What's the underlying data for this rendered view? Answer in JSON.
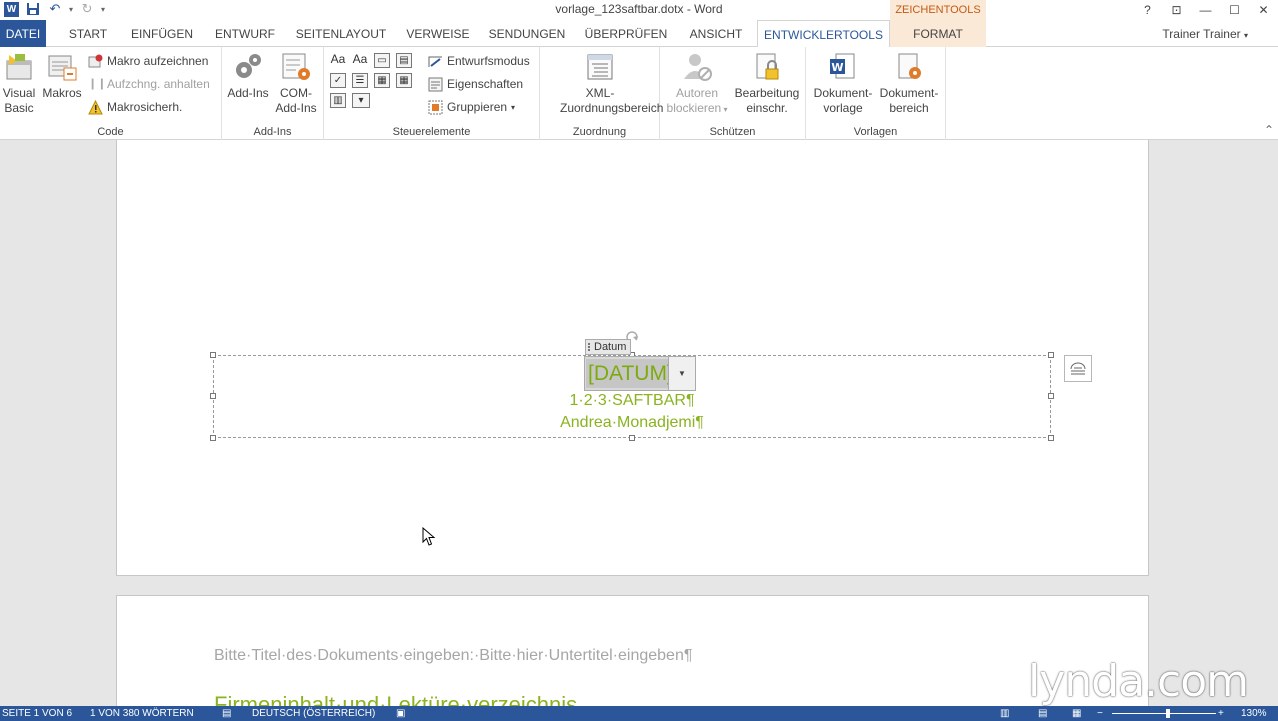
{
  "window": {
    "title": "vorlage_123saftbar.dotx - Word",
    "context_tab_group": "ZEICHENTOOLS",
    "controls": [
      "?",
      "⊡",
      "—",
      "☐",
      "✕"
    ]
  },
  "tabs": [
    {
      "label": "DATEI"
    },
    {
      "label": "START"
    },
    {
      "label": "EINFÜGEN"
    },
    {
      "label": "ENTWURF"
    },
    {
      "label": "SEITENLAYOUT"
    },
    {
      "label": "VERWEISE"
    },
    {
      "label": "SENDUNGEN"
    },
    {
      "label": "ÜBERPRÜFEN"
    },
    {
      "label": "ANSICHT"
    },
    {
      "label": "ENTWICKLERTOOLS"
    },
    {
      "label": "FORMAT"
    }
  ],
  "user": "Trainer Trainer",
  "ribbon": {
    "code": {
      "label": "Code",
      "visual_basic": "Visual Basic",
      "makros": "Makros",
      "makro_aufzeichnen": "Makro aufzeichnen",
      "aufzeichnung_anhalten": "Aufzchng. anhalten",
      "makrosicherheit": "Makrosicherh."
    },
    "addins": {
      "label": "Add-Ins",
      "add_ins": "Add-Ins",
      "com_add_ins": "COM-Add-Ins"
    },
    "steuerelemente": {
      "label": "Steuerelemente",
      "entwurfsmodus": "Entwurfsmodus",
      "eigenschaften": "Eigenschaften",
      "gruppieren": "Gruppieren"
    },
    "zuordnung": {
      "label": "Zuordnung",
      "xml": "XML-Zuordnungsbereich"
    },
    "schuetzen": {
      "label": "Schützen",
      "autoren_blockieren": "Autoren blockieren",
      "bearbeitung": "Bearbeitung einschr."
    },
    "vorlagen": {
      "label": "Vorlagen",
      "dokumentvorlage": "Dokument-vorlage",
      "dokumentbereich": "Dokument-bereich"
    }
  },
  "document": {
    "control_tag": "Datum",
    "date_placeholder": "[DATUM]¶",
    "company": "1·2·3·SAFTBAR¶",
    "author": "Andrea·Monadjemi¶",
    "page2_subtitle": "Bitte·Titel·des·Dokuments·eingeben:·Bitte·hier·Untertitel·eingeben¶",
    "page2_heading": "Firmeninhalt·und·Lektüre·verzeichnis"
  },
  "status": {
    "page": "SEITE 1 VON 6",
    "words": "1 VON 380 WÖRTERN",
    "language": "DEUTSCH (ÖSTERREICH)",
    "zoom": "130%"
  },
  "watermark": "lynda.com",
  "colors": {
    "word_blue": "#2b579a",
    "accent_green": "#8ab31f",
    "context_orange": "#c55a11"
  }
}
